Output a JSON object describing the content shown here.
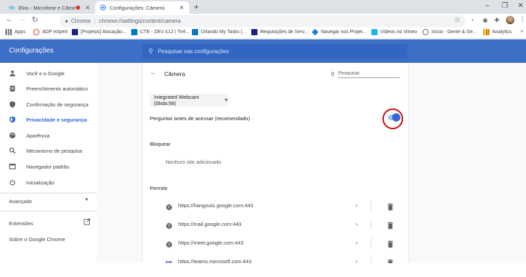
{
  "tabs": [
    {
      "title": "Elos - Microfone e Câmera",
      "recording": true,
      "active": false
    },
    {
      "title": "Configurações: Câmera",
      "active": true
    }
  ],
  "toolbar": {
    "site_chip": "Chrome",
    "url": "chrome://settings/content/camera"
  },
  "bookmarks": [
    {
      "label": "Apps",
      "icon": "apps-grid-icon",
      "color": "#5f6368"
    },
    {
      "label": "ADP eXpert",
      "icon": "adp-icon",
      "color": "#d93025"
    },
    {
      "label": "[Projetos] Alocação...",
      "icon": "projects-icon",
      "color": "#1a237e"
    },
    {
      "label": "CTE - DEV £12 | Trel...",
      "icon": "trello-icon",
      "color": "#0079bf"
    },
    {
      "label": "Orlando My Tasks |...",
      "icon": "trello-icon",
      "color": "#0079bf"
    },
    {
      "label": "Requisições de Serv...",
      "icon": "service-icon",
      "color": "#1a237e"
    },
    {
      "label": "Navegar nos Projet...",
      "icon": "diamond-icon",
      "color": "#1a73e8"
    },
    {
      "label": "Vídeos no Vimeo",
      "icon": "vimeo-icon",
      "color": "#1ab7ea"
    },
    {
      "label": "Início - Gente & Ge...",
      "icon": "globe-icon",
      "color": "#5f6368"
    },
    {
      "label": "Analytics",
      "icon": "analytics-icon",
      "color": "#f9ab00"
    }
  ],
  "header": {
    "title": "Configurações",
    "search_placeholder": "Pesquisar nas configurações"
  },
  "sidebar": {
    "items": [
      {
        "label": "Você e o Google",
        "icon": "person-icon",
        "selected": false
      },
      {
        "label": "Preenchimento automático",
        "icon": "clipboard-icon",
        "selected": false
      },
      {
        "label": "Confirmação de segurança",
        "icon": "shield-icon",
        "selected": false
      },
      {
        "label": "Privacidade e segurança",
        "icon": "privacy-shield-icon",
        "selected": true
      },
      {
        "label": "Aparência",
        "icon": "palette-icon",
        "selected": false
      },
      {
        "label": "Mecanismo de pesquisa",
        "icon": "search-icon",
        "selected": false
      },
      {
        "label": "Navegador padrão",
        "icon": "browser-icon",
        "selected": false
      },
      {
        "label": "Inicialização",
        "icon": "power-icon",
        "selected": false
      }
    ],
    "advanced": "Avançado",
    "extensions": "Extensões",
    "about": "Sobre o Google Chrome"
  },
  "main": {
    "title": "Câmera",
    "search_placeholder": "Pesquisar",
    "camera_device": "Integrated Webcam (0bda:56(",
    "ask_label": "Perguntar antes de acessar (recomendado)",
    "ask_enabled": true,
    "block_title": "Bloquear",
    "block_empty": "Nenhum site adicionado",
    "allow_title": "Permitir",
    "allowed_sites": [
      {
        "url": "https://hangouts.google.com:443",
        "icon": "globe-icon"
      },
      {
        "url": "https://mail.google.com:443",
        "icon": "globe-icon"
      },
      {
        "url": "https://meet.google.com:443",
        "icon": "globe-icon"
      },
      {
        "url": "https://teams.microsoft.com:443",
        "icon": "teams-icon"
      }
    ]
  },
  "colors": {
    "header_blue": "#3d6fc6",
    "accent": "#3367d6",
    "highlight_ring": "#d40000"
  }
}
